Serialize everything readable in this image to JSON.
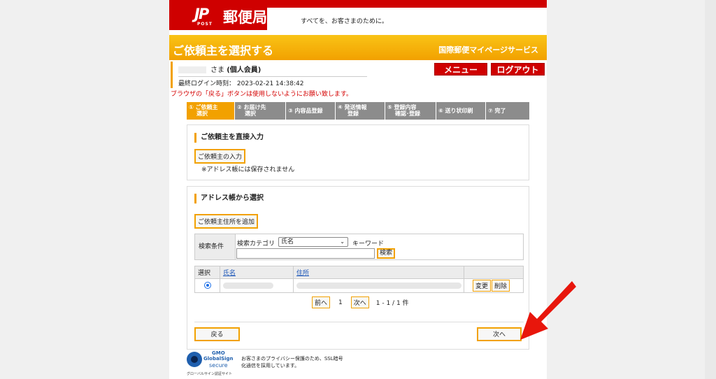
{
  "header": {
    "logo_mark": "JP",
    "logo_post": "POST",
    "logo_text": "郵便局",
    "tagline": "すべてを、お客さまのために。",
    "page_title": "ご依頼主を選択する",
    "service_name": "国際郵便マイページサービス"
  },
  "user": {
    "name_suffix": "さま",
    "member_type": "(個人会員)",
    "last_login": "最終ログイン時刻： 2023-02-21 14:38:42",
    "menu_label": "メニュー",
    "logout_label": "ログアウト"
  },
  "warning": "ブラウザの「戻る」ボタンは使用しないようにお願い致します。",
  "steps": [
    {
      "line1": "① ご依頼主",
      "line2": "選択",
      "active": true
    },
    {
      "line1": "② お届け先",
      "line2": "選択",
      "active": false
    },
    {
      "line1": "③ 内容品登録",
      "line2": "",
      "active": false
    },
    {
      "line1": "④ 発送情報",
      "line2": "登録",
      "active": false
    },
    {
      "line1": "⑤ 登録内容",
      "line2": "確認･登録",
      "active": false
    },
    {
      "line1": "⑥ 送り状印刷",
      "line2": "",
      "active": false
    },
    {
      "line1": "⑦ 完了",
      "line2": "",
      "active": false
    }
  ],
  "direct_section": {
    "heading": "ご依頼主を直接入力",
    "button": "ご依頼主の入力",
    "note": "※アドレス帳には保存されません"
  },
  "address_section": {
    "heading": "アドレス帳から選択",
    "add_button": "ご依頼主住所を追加",
    "search": {
      "label": "検索条件",
      "category_label": "検索カテゴリ",
      "category_value": "氏名",
      "keyword_label": "キーワード",
      "keyword_value": "",
      "search_button": "検索"
    },
    "table": {
      "headers": [
        "選択",
        "氏名",
        "住所",
        ""
      ],
      "rows": [
        {
          "selected": true,
          "edit": "変更",
          "delete": "削除"
        }
      ]
    },
    "pager": {
      "prev": "前へ",
      "page": "1",
      "next": "次へ",
      "summary": "1 - 1 / 1 件"
    },
    "back_button": "戻る",
    "next_button": "次へ"
  },
  "footer": {
    "gs_gmo": "GMO",
    "gs_name": "GlobalSign",
    "gs_secure": "secure",
    "gs_caption": "グローバルサイン認証サイト",
    "ssl_text": "お客さまのプライバシー保護のため、SSL暗号化通信を採用しています。"
  },
  "colors": {
    "brand_red": "#cf0000",
    "accent_orange": "#f2a100",
    "arrow_red": "#e8160c"
  }
}
